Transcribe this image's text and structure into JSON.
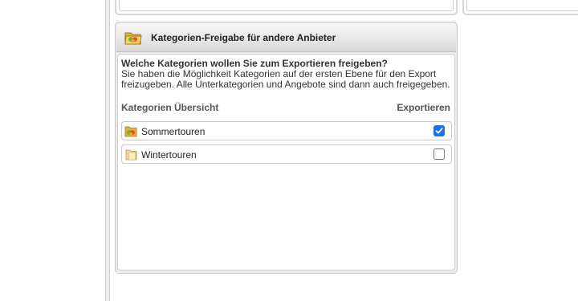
{
  "panel": {
    "title": "Kategorien-Freigabe für andere Anbieter",
    "question_head": "Welche Kategorien wollen Sie zum Exportieren freigeben?",
    "question_text": "Sie haben die Möglichkeit Kategorien auf der ersten Ebene für den Export freizugeben. Alle Unterkategorien und Angebote sind dann auch freigegeben.",
    "col_overview": "Kategorien Übersicht",
    "col_export": "Exportieren"
  },
  "categories": [
    {
      "label": "Sommertouren",
      "icon": "summer-folder-icon",
      "exported": true
    },
    {
      "label": "Wintertouren",
      "icon": "folder-icon",
      "exported": false
    }
  ],
  "colors": {
    "accent": "#1a73e8",
    "header_gradient_top": "#f7f7f7",
    "header_gradient_bottom": "#d9d9d9",
    "border": "#c9c9c9"
  }
}
